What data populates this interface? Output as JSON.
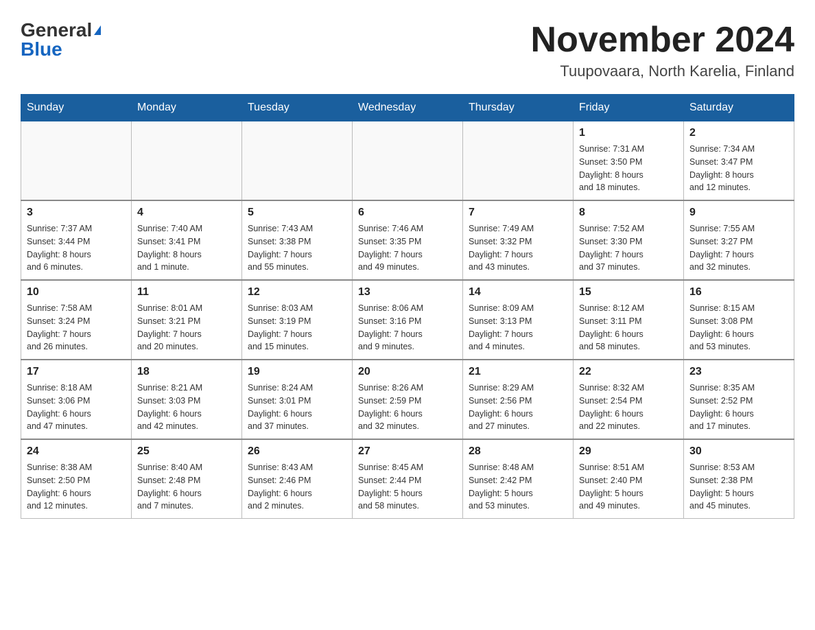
{
  "header": {
    "logo_general": "General",
    "logo_blue": "Blue",
    "month_title": "November 2024",
    "location": "Tuupovaara, North Karelia, Finland"
  },
  "weekdays": [
    "Sunday",
    "Monday",
    "Tuesday",
    "Wednesday",
    "Thursday",
    "Friday",
    "Saturday"
  ],
  "weeks": [
    [
      {
        "day": "",
        "info": ""
      },
      {
        "day": "",
        "info": ""
      },
      {
        "day": "",
        "info": ""
      },
      {
        "day": "",
        "info": ""
      },
      {
        "day": "",
        "info": ""
      },
      {
        "day": "1",
        "info": "Sunrise: 7:31 AM\nSunset: 3:50 PM\nDaylight: 8 hours\nand 18 minutes."
      },
      {
        "day": "2",
        "info": "Sunrise: 7:34 AM\nSunset: 3:47 PM\nDaylight: 8 hours\nand 12 minutes."
      }
    ],
    [
      {
        "day": "3",
        "info": "Sunrise: 7:37 AM\nSunset: 3:44 PM\nDaylight: 8 hours\nand 6 minutes."
      },
      {
        "day": "4",
        "info": "Sunrise: 7:40 AM\nSunset: 3:41 PM\nDaylight: 8 hours\nand 1 minute."
      },
      {
        "day": "5",
        "info": "Sunrise: 7:43 AM\nSunset: 3:38 PM\nDaylight: 7 hours\nand 55 minutes."
      },
      {
        "day": "6",
        "info": "Sunrise: 7:46 AM\nSunset: 3:35 PM\nDaylight: 7 hours\nand 49 minutes."
      },
      {
        "day": "7",
        "info": "Sunrise: 7:49 AM\nSunset: 3:32 PM\nDaylight: 7 hours\nand 43 minutes."
      },
      {
        "day": "8",
        "info": "Sunrise: 7:52 AM\nSunset: 3:30 PM\nDaylight: 7 hours\nand 37 minutes."
      },
      {
        "day": "9",
        "info": "Sunrise: 7:55 AM\nSunset: 3:27 PM\nDaylight: 7 hours\nand 32 minutes."
      }
    ],
    [
      {
        "day": "10",
        "info": "Sunrise: 7:58 AM\nSunset: 3:24 PM\nDaylight: 7 hours\nand 26 minutes."
      },
      {
        "day": "11",
        "info": "Sunrise: 8:01 AM\nSunset: 3:21 PM\nDaylight: 7 hours\nand 20 minutes."
      },
      {
        "day": "12",
        "info": "Sunrise: 8:03 AM\nSunset: 3:19 PM\nDaylight: 7 hours\nand 15 minutes."
      },
      {
        "day": "13",
        "info": "Sunrise: 8:06 AM\nSunset: 3:16 PM\nDaylight: 7 hours\nand 9 minutes."
      },
      {
        "day": "14",
        "info": "Sunrise: 8:09 AM\nSunset: 3:13 PM\nDaylight: 7 hours\nand 4 minutes."
      },
      {
        "day": "15",
        "info": "Sunrise: 8:12 AM\nSunset: 3:11 PM\nDaylight: 6 hours\nand 58 minutes."
      },
      {
        "day": "16",
        "info": "Sunrise: 8:15 AM\nSunset: 3:08 PM\nDaylight: 6 hours\nand 53 minutes."
      }
    ],
    [
      {
        "day": "17",
        "info": "Sunrise: 8:18 AM\nSunset: 3:06 PM\nDaylight: 6 hours\nand 47 minutes."
      },
      {
        "day": "18",
        "info": "Sunrise: 8:21 AM\nSunset: 3:03 PM\nDaylight: 6 hours\nand 42 minutes."
      },
      {
        "day": "19",
        "info": "Sunrise: 8:24 AM\nSunset: 3:01 PM\nDaylight: 6 hours\nand 37 minutes."
      },
      {
        "day": "20",
        "info": "Sunrise: 8:26 AM\nSunset: 2:59 PM\nDaylight: 6 hours\nand 32 minutes."
      },
      {
        "day": "21",
        "info": "Sunrise: 8:29 AM\nSunset: 2:56 PM\nDaylight: 6 hours\nand 27 minutes."
      },
      {
        "day": "22",
        "info": "Sunrise: 8:32 AM\nSunset: 2:54 PM\nDaylight: 6 hours\nand 22 minutes."
      },
      {
        "day": "23",
        "info": "Sunrise: 8:35 AM\nSunset: 2:52 PM\nDaylight: 6 hours\nand 17 minutes."
      }
    ],
    [
      {
        "day": "24",
        "info": "Sunrise: 8:38 AM\nSunset: 2:50 PM\nDaylight: 6 hours\nand 12 minutes."
      },
      {
        "day": "25",
        "info": "Sunrise: 8:40 AM\nSunset: 2:48 PM\nDaylight: 6 hours\nand 7 minutes."
      },
      {
        "day": "26",
        "info": "Sunrise: 8:43 AM\nSunset: 2:46 PM\nDaylight: 6 hours\nand 2 minutes."
      },
      {
        "day": "27",
        "info": "Sunrise: 8:45 AM\nSunset: 2:44 PM\nDaylight: 5 hours\nand 58 minutes."
      },
      {
        "day": "28",
        "info": "Sunrise: 8:48 AM\nSunset: 2:42 PM\nDaylight: 5 hours\nand 53 minutes."
      },
      {
        "day": "29",
        "info": "Sunrise: 8:51 AM\nSunset: 2:40 PM\nDaylight: 5 hours\nand 49 minutes."
      },
      {
        "day": "30",
        "info": "Sunrise: 8:53 AM\nSunset: 2:38 PM\nDaylight: 5 hours\nand 45 minutes."
      }
    ]
  ]
}
